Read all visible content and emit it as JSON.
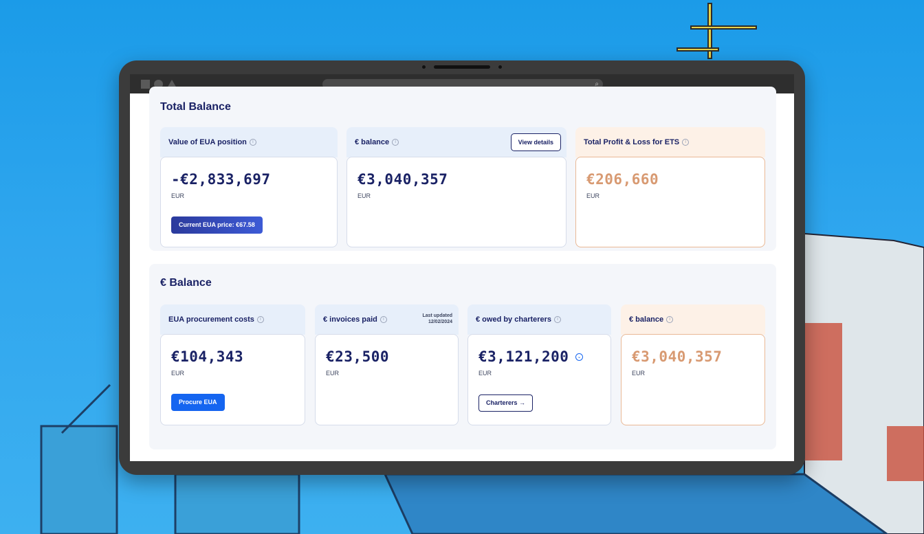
{
  "colors": {
    "navy": "#1a2265",
    "orange_value": "#d89a72",
    "primary_blue": "#1565f0",
    "card_head_blue": "#e7effa",
    "card_head_orange": "#fdf1e7"
  },
  "browser": {
    "search_icon": "search-icon"
  },
  "total_balance": {
    "title": "Total Balance",
    "cards": [
      {
        "label": "Value of EUA position",
        "amount": "-€2,833,697",
        "currency": "EUR",
        "button": "Current EUA price: €67.58"
      },
      {
        "label": "€ balance",
        "amount": "€3,040,357",
        "currency": "EUR",
        "button": "View details"
      },
      {
        "label": "Total Profit & Loss for ETS",
        "amount": "€206,660",
        "currency": "EUR"
      }
    ]
  },
  "euro_balance": {
    "title": "€ Balance",
    "cards": [
      {
        "label": "EUA procurement costs",
        "amount": "€104,343",
        "currency": "EUR",
        "button": "Procure EUA"
      },
      {
        "label": "€ invoices paid",
        "amount": "€23,500",
        "currency": "EUR",
        "last_updated_label": "Last updated",
        "last_updated_date": "12/02/2024"
      },
      {
        "label": "€ owed by charterers",
        "amount": "€3,121,200",
        "currency": "EUR",
        "button": "Charterers →"
      },
      {
        "label": "€ balance",
        "amount": "€3,040,357",
        "currency": "EUR"
      }
    ]
  }
}
